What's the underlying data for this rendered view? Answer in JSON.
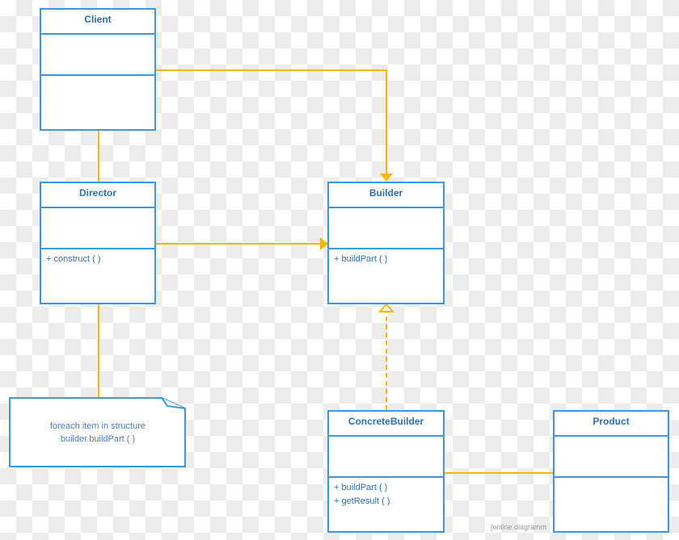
{
  "colors": {
    "box_border": "#3d96e0",
    "text": "#2f6fae",
    "connector": "#f5b800"
  },
  "classes": {
    "client": {
      "name": "Client",
      "operations": []
    },
    "director": {
      "name": "Director",
      "operations": [
        "+ construct ( )"
      ]
    },
    "builder": {
      "name": "Builder",
      "operations": [
        "+ buildPart ( )"
      ]
    },
    "concrete_builder": {
      "name": "ConcreteBuilder",
      "operations": [
        "+ buildPart ( )",
        "+ getResult ( )"
      ]
    },
    "product": {
      "name": "Product",
      "operations": []
    }
  },
  "note": {
    "lines": [
      "foreach item in structure",
      "builder.buildPart ( )"
    ]
  },
  "watermark": "[online diagramm"
}
